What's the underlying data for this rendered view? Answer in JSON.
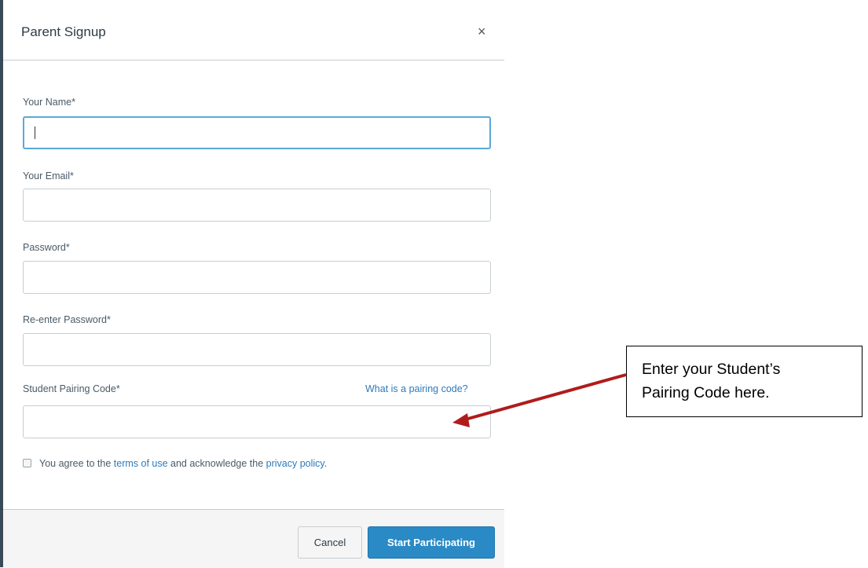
{
  "modal": {
    "title": "Parent Signup",
    "close_symbol": "×"
  },
  "form": {
    "name_label": "Your Name*",
    "email_label": "Your Email*",
    "password_label": "Password*",
    "reenter_label": "Re-enter Password*",
    "pairing_label": "Student Pairing Code*",
    "pairing_help_link": "What is a pairing code?",
    "name_value": "",
    "email_value": "",
    "password_value": "",
    "reenter_value": "",
    "pairing_value": ""
  },
  "agreement": {
    "prefix": "You agree to the ",
    "terms_link": "terms of use",
    "middle": " and acknowledge the ",
    "privacy_link": "privacy policy",
    "suffix": ".",
    "checked": false
  },
  "footer": {
    "cancel_label": "Cancel",
    "start_label": "Start Participating"
  },
  "callout": {
    "line1": "Enter your Student’s",
    "line2": "Pairing Code here."
  },
  "icons": {
    "close": "close-icon",
    "arrow": "arrow-icon"
  },
  "colors": {
    "primary_button": "#2a8ac5",
    "link": "#2b7abc",
    "focus_border": "#5aa8d8",
    "arrow": "#b01c1c"
  }
}
